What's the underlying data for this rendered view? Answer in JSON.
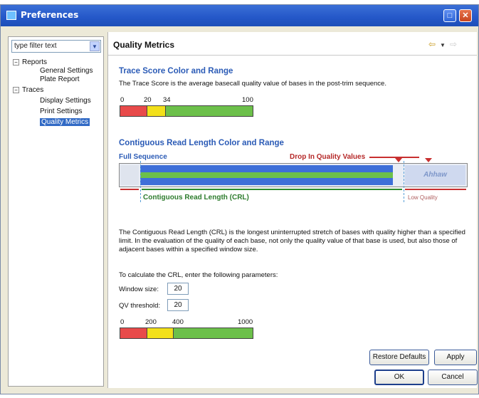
{
  "window": {
    "title": "Preferences"
  },
  "sidebar": {
    "filter_placeholder": "type filter text",
    "items": [
      {
        "label": "Reports",
        "level": 1,
        "toggle": "−"
      },
      {
        "label": "General Settings",
        "level": 2
      },
      {
        "label": "Plate Report",
        "level": 2
      },
      {
        "label": "Traces",
        "level": 1,
        "toggle": "−"
      },
      {
        "label": "Display Settings",
        "level": 2
      },
      {
        "label": "Print Settings",
        "level": 2
      },
      {
        "label": "Quality Metrics",
        "level": 2,
        "selected": true
      }
    ]
  },
  "main": {
    "title": "Quality Metrics",
    "trace_score": {
      "heading": "Trace Score Color and Range",
      "description": "The Trace Score is the average basecall quality value of bases in the post-trim sequence.",
      "scale_labels": [
        "0",
        "20",
        "34",
        "100"
      ],
      "segments": [
        {
          "value": 20,
          "color": "#e84a4a"
        },
        {
          "value": 14,
          "color": "#f2e01a"
        },
        {
          "value": 66,
          "color": "#6cc04a"
        }
      ]
    },
    "crl": {
      "heading": "Contiguous Read Length Color and Range",
      "full_sequence_label": "Full Sequence",
      "drop_label": "Drop In Quality Values",
      "crl_label": "Contiguous Read Length (CRL)",
      "low_quality_label": "Low Quality",
      "description": "The Contiguous Read Length (CRL) is the longest uninterrupted stretch of bases with quality higher than a specified limit.  In the evaluation of the quality of each base, not only the quality value of that base is used, but also those of adjacent bases within a specified window size.",
      "params_intro": "To calculate the CRL, enter the following parameters:",
      "window_size_label": "Window size:",
      "window_size_value": "20",
      "qv_threshold_label": "QV threshold:",
      "qv_threshold_value": "20",
      "scale_labels": [
        "0",
        "200",
        "400",
        "1000"
      ],
      "segments": [
        {
          "value": 200,
          "color": "#e84a4a"
        },
        {
          "value": 200,
          "color": "#f2e01a"
        },
        {
          "value": 600,
          "color": "#6cc04a"
        }
      ]
    }
  },
  "buttons": {
    "restore_defaults": "Restore Defaults",
    "apply": "Apply",
    "ok": "OK",
    "cancel": "Cancel"
  }
}
